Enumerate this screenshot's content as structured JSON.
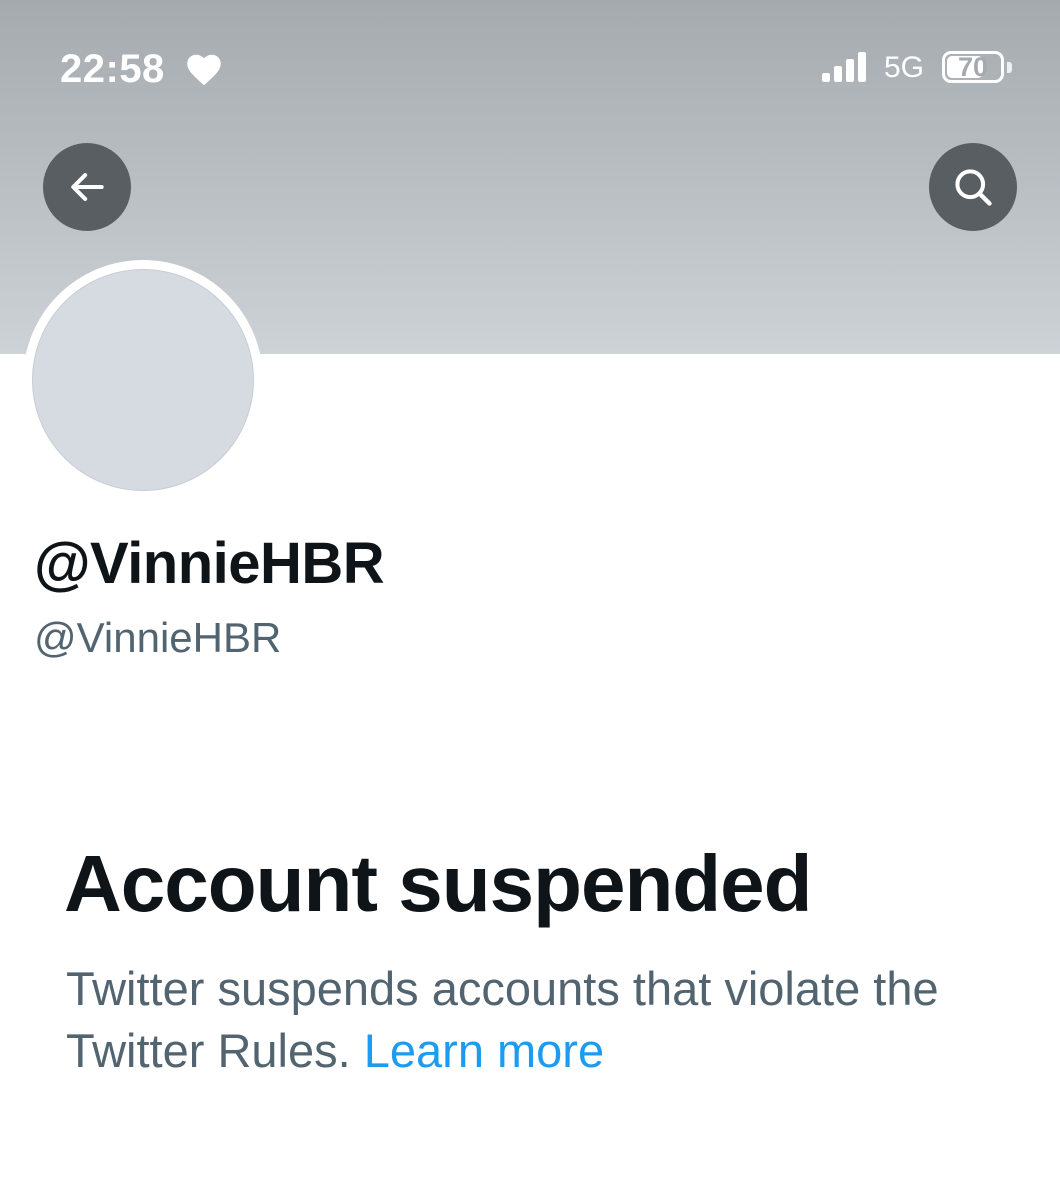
{
  "status_bar": {
    "time": "22:58",
    "network": "5G",
    "battery_percent": "70",
    "battery_level": 0.7,
    "heart_icon": "heart-icon",
    "signal_icon": "cellular-signal-icon"
  },
  "header": {
    "back_icon": "arrow-left-icon",
    "search_icon": "search-icon",
    "button_color": "#595e63"
  },
  "profile": {
    "display_name": "@VinnieHBR",
    "handle": "@VinnieHBR"
  },
  "suspension": {
    "title": "Account suspended",
    "message": "Twitter suspends accounts that violate the Twitter Rules.",
    "link_text": "Learn more"
  },
  "colors": {
    "text_primary": "#0f1419",
    "text_secondary": "#536471",
    "link": "#1d9bf0"
  }
}
